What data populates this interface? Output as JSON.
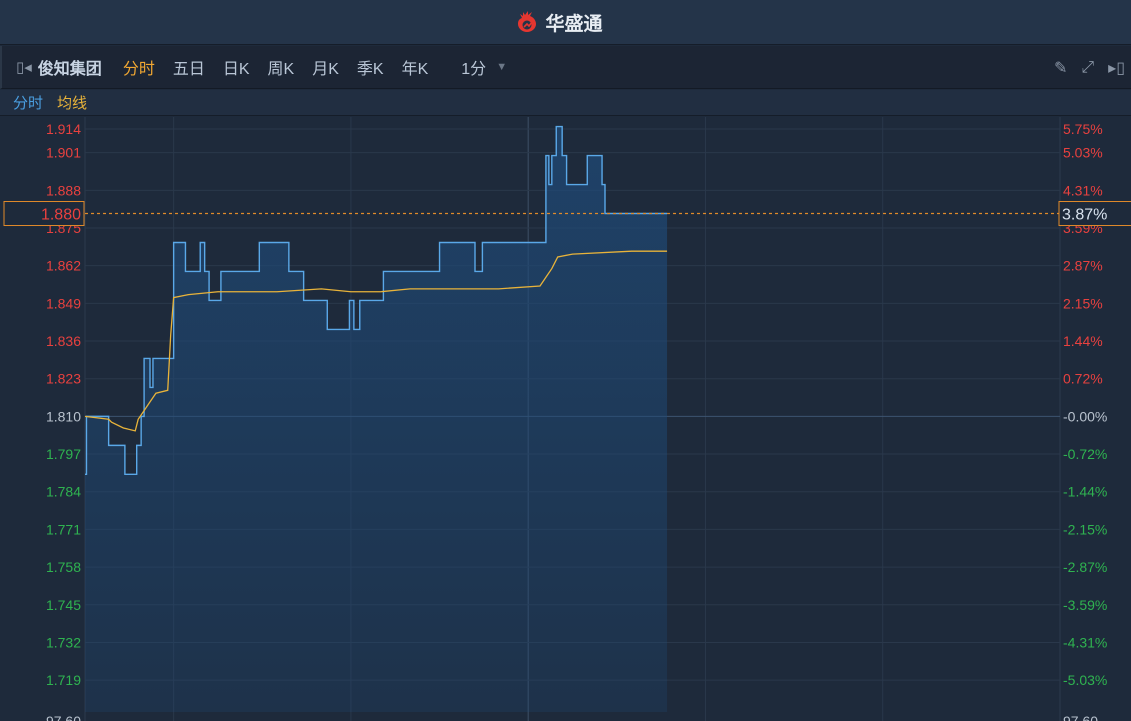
{
  "header": {
    "brand": "华盛通"
  },
  "toolbar": {
    "stock_name": "俊知集团",
    "tabs": [
      {
        "label": "分时",
        "active": true
      },
      {
        "label": "五日"
      },
      {
        "label": "日K"
      },
      {
        "label": "周K"
      },
      {
        "label": "月K"
      },
      {
        "label": "季K"
      },
      {
        "label": "年K"
      }
    ],
    "period": "1分"
  },
  "legend": {
    "price": "分时",
    "avg": "均线"
  },
  "colors": {
    "up": "#e8413f",
    "down": "#2fb350",
    "price_line": "#5aa8e8",
    "avg_line": "#e8b33a",
    "crosshair": "#e08a2a"
  },
  "chart_data": {
    "type": "line",
    "x_unit": "minutes since open",
    "xlim": [
      0,
      330
    ],
    "ylim": [
      1.708,
      1.9133
    ],
    "prev_close": 1.81,
    "x_grid": [
      30,
      90,
      150,
      210,
      270
    ],
    "left_ticks": [
      "1.914",
      "1.901",
      "1.888",
      "1.875",
      "1.862",
      "1.849",
      "1.836",
      "1.823",
      "1.810",
      "1.797",
      "1.784",
      "1.771",
      "1.758",
      "1.745",
      "1.732",
      "1.719"
    ],
    "right_ticks": [
      "5.75%",
      "5.03%",
      "4.31%",
      "3.59%",
      "2.87%",
      "2.15%",
      "1.44%",
      "0.72%",
      "-0.00%",
      "-0.72%",
      "-1.44%",
      "-2.15%",
      "-2.87%",
      "-3.59%",
      "-4.31%",
      "-5.03%"
    ],
    "bottom_left": "97.60",
    "bottom_right": "97.60",
    "crosshair": {
      "price": "1.880",
      "pct": "3.87%",
      "value": 1.88
    },
    "price_steps": [
      [
        0,
        1.79
      ],
      [
        0.5,
        1.81
      ],
      [
        8,
        1.8
      ],
      [
        13.5,
        1.79
      ],
      [
        17.5,
        1.8
      ],
      [
        19,
        1.81
      ],
      [
        20,
        1.83
      ],
      [
        22,
        1.82
      ],
      [
        23,
        1.83
      ],
      [
        30,
        1.87
      ],
      [
        34,
        1.86
      ],
      [
        39,
        1.87
      ],
      [
        40.5,
        1.86
      ],
      [
        42,
        1.85
      ],
      [
        46,
        1.86
      ],
      [
        59,
        1.87
      ],
      [
        69,
        1.86
      ],
      [
        74,
        1.85
      ],
      [
        82,
        1.84
      ],
      [
        89.5,
        1.85
      ],
      [
        91,
        1.84
      ],
      [
        93,
        1.85
      ],
      [
        101,
        1.86
      ],
      [
        120,
        1.87
      ],
      [
        132,
        1.86
      ],
      [
        134.5,
        1.87
      ],
      [
        156,
        1.9
      ],
      [
        157,
        1.89
      ],
      [
        158,
        1.9
      ],
      [
        159.5,
        1.91
      ],
      [
        161.5,
        1.9
      ],
      [
        163,
        1.89
      ],
      [
        170,
        1.9
      ],
      [
        175,
        1.89
      ],
      [
        176,
        1.88
      ],
      [
        197,
        1.88
      ]
    ],
    "avg_points": [
      [
        0,
        1.81
      ],
      [
        8,
        1.809
      ],
      [
        9,
        1.808
      ],
      [
        13,
        1.806
      ],
      [
        17,
        1.805
      ],
      [
        18,
        1.809
      ],
      [
        20,
        1.812
      ],
      [
        22,
        1.815
      ],
      [
        24,
        1.818
      ],
      [
        28,
        1.819
      ],
      [
        29,
        1.838
      ],
      [
        30,
        1.851
      ],
      [
        35,
        1.852
      ],
      [
        45,
        1.853
      ],
      [
        65,
        1.853
      ],
      [
        80,
        1.854
      ],
      [
        90,
        1.853
      ],
      [
        100,
        1.853
      ],
      [
        110,
        1.854
      ],
      [
        140,
        1.854
      ],
      [
        154,
        1.855
      ],
      [
        156,
        1.858
      ],
      [
        158,
        1.861
      ],
      [
        160,
        1.865
      ],
      [
        165,
        1.866
      ],
      [
        185,
        1.867
      ],
      [
        197,
        1.867
      ]
    ]
  }
}
